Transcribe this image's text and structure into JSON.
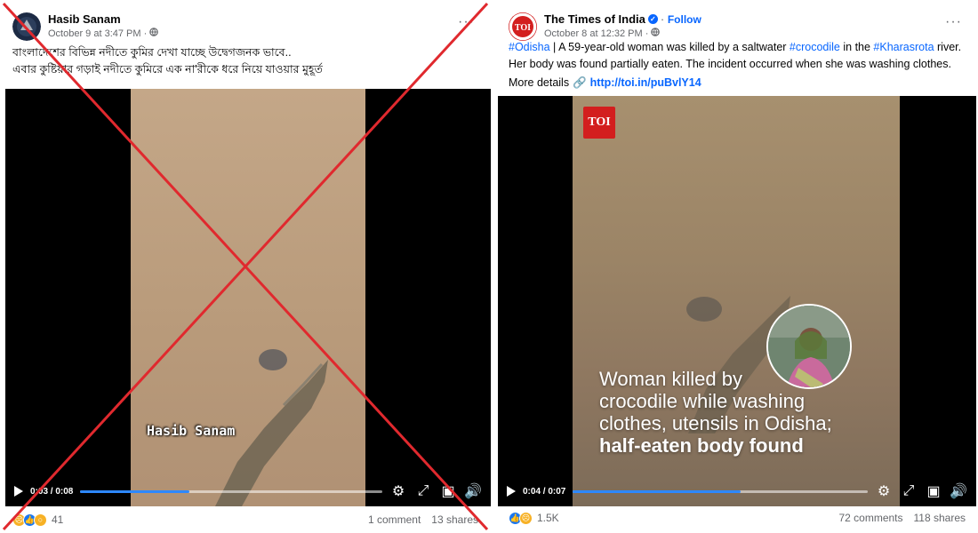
{
  "left_post": {
    "author": "Hasib Sanam",
    "timestamp": "October 9 at 3:47 PM ·",
    "audience_icon": "globe-icon",
    "more_icon": "···",
    "caption_line1": "বাংলাদেশের বিভিন্ন নদীতে কুমির দেখা যাচ্ছে উদ্বেগজনক ভাবে..",
    "caption_line2": "এবার কুষ্টিয়ার গড়াই নদীতে কুমিরে এক না'রীকে ধরে নিয়ে যাওয়ার মুহূর্ত",
    "video": {
      "watermark": "Hasib Sanam",
      "time": "0:03 / 0:08",
      "progress": 0.36
    },
    "reactions_count": "41",
    "comments": "1 comment",
    "shares": "13 shares"
  },
  "right_post": {
    "author": "The Times of India",
    "follow": "Follow",
    "timestamp": "October 8 at 12:32 PM ·",
    "more_icon": "···",
    "caption": {
      "tag1": "#Odisha",
      "text1": " | A 59-year-old woman was killed by a saltwater ",
      "tag2": "#crocodile",
      "text2": " in the ",
      "tag3": "#Kharasrota",
      "text3": " river. Her body was found partially eaten. The incident occurred when she was washing clothes.",
      "more_label": "More details",
      "link": "http://toi.in/puBvlY14"
    },
    "video": {
      "logo": "TOI",
      "headline_line1": "Woman killed by",
      "headline_line2": "crocodile while washing",
      "headline_line3": "clothes, utensils in Odisha;",
      "headline_bold": "half-eaten body found",
      "time": "0:04 / 0:07",
      "progress": 0.57
    },
    "reactions_count": "1.5K",
    "comments": "72 comments",
    "shares": "118 shares"
  },
  "colors": {
    "cross": "#e0292e",
    "accent": "#0866ff",
    "water": "#b89d7c"
  }
}
